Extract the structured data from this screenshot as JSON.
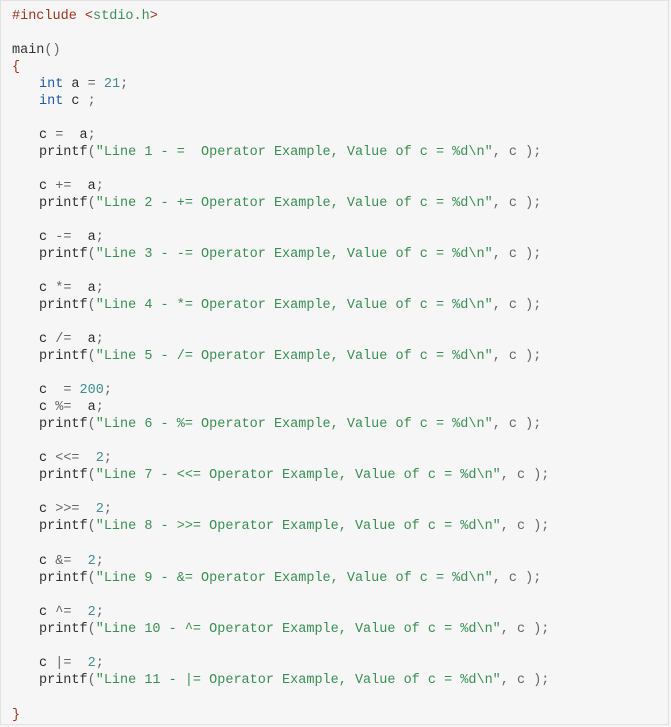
{
  "code": {
    "include_directive": "#include",
    "include_lt": "<",
    "include_header": "stdio.h",
    "include_gt": ">",
    "main_name": "main",
    "main_parens": "()",
    "brace_open": "{",
    "brace_close": "}",
    "decl_a": {
      "type": "int",
      "name": "a",
      "op": "=",
      "value": "21",
      "end": ";"
    },
    "decl_c": {
      "type": "int",
      "name": "c",
      "end": ";"
    },
    "assign_lines": [
      {
        "lhs": "c",
        "op": "=",
        "rhs": "a",
        "end": ";"
      },
      {
        "lhs": "c",
        "op": "+=",
        "rhs": "a",
        "end": ";"
      },
      {
        "lhs": "c",
        "op": "-=",
        "rhs": "a",
        "end": ";"
      },
      {
        "lhs": "c",
        "op": "*=",
        "rhs": "a",
        "end": ";"
      },
      {
        "lhs": "c",
        "op": "/=",
        "rhs": "a",
        "end": ";"
      },
      {
        "lhs": "c",
        "op": "=",
        "rhs": "200",
        "end": ";"
      },
      {
        "lhs": "c",
        "op": "%=",
        "rhs": "a",
        "end": ";"
      },
      {
        "lhs": "c",
        "op": "<<=",
        "rhs": "2",
        "end": ";"
      },
      {
        "lhs": "c",
        "op": ">>=",
        "rhs": "2",
        "end": ";"
      },
      {
        "lhs": "c",
        "op": "&=",
        "rhs": "2",
        "end": ";"
      },
      {
        "lhs": "c",
        "op": "^=",
        "rhs": "2",
        "end": ";"
      },
      {
        "lhs": "c",
        "op": "|=",
        "rhs": "2",
        "end": ";"
      }
    ],
    "printf_lines": [
      {
        "fn": "printf",
        "open": "(",
        "str": "\"Line 1 - =  Operator Example, Value of c = %d\\n\"",
        "rest": ", c );"
      },
      {
        "fn": "printf",
        "open": "(",
        "str": "\"Line 2 - += Operator Example, Value of c = %d\\n\"",
        "rest": ", c );"
      },
      {
        "fn": "printf",
        "open": "(",
        "str": "\"Line 3 - -= Operator Example, Value of c = %d\\n\"",
        "rest": ", c );"
      },
      {
        "fn": "printf",
        "open": "(",
        "str": "\"Line 4 - *= Operator Example, Value of c = %d\\n\"",
        "rest": ", c );"
      },
      {
        "fn": "printf",
        "open": "(",
        "str": "\"Line 5 - /= Operator Example, Value of c = %d\\n\"",
        "rest": ", c );"
      },
      {
        "fn": "printf",
        "open": "(",
        "str": "\"Line 6 - %= Operator Example, Value of c = %d\\n\"",
        "rest": ", c );"
      },
      {
        "fn": "printf",
        "open": "(",
        "str": "\"Line 7 - <<= Operator Example, Value of c = %d\\n\"",
        "rest": ", c );"
      },
      {
        "fn": "printf",
        "open": "(",
        "str": "\"Line 8 - >>= Operator Example, Value of c = %d\\n\"",
        "rest": ", c );"
      },
      {
        "fn": "printf",
        "open": "(",
        "str": "\"Line 9 - &= Operator Example, Value of c = %d\\n\"",
        "rest": ", c );"
      },
      {
        "fn": "printf",
        "open": "(",
        "str": "\"Line 10 - ^= Operator Example, Value of c = %d\\n\"",
        "rest": ", c );"
      },
      {
        "fn": "printf",
        "open": "(",
        "str": "\"Line 11 - |= Operator Example, Value of c = %d\\n\"",
        "rest": ", c );"
      }
    ]
  }
}
